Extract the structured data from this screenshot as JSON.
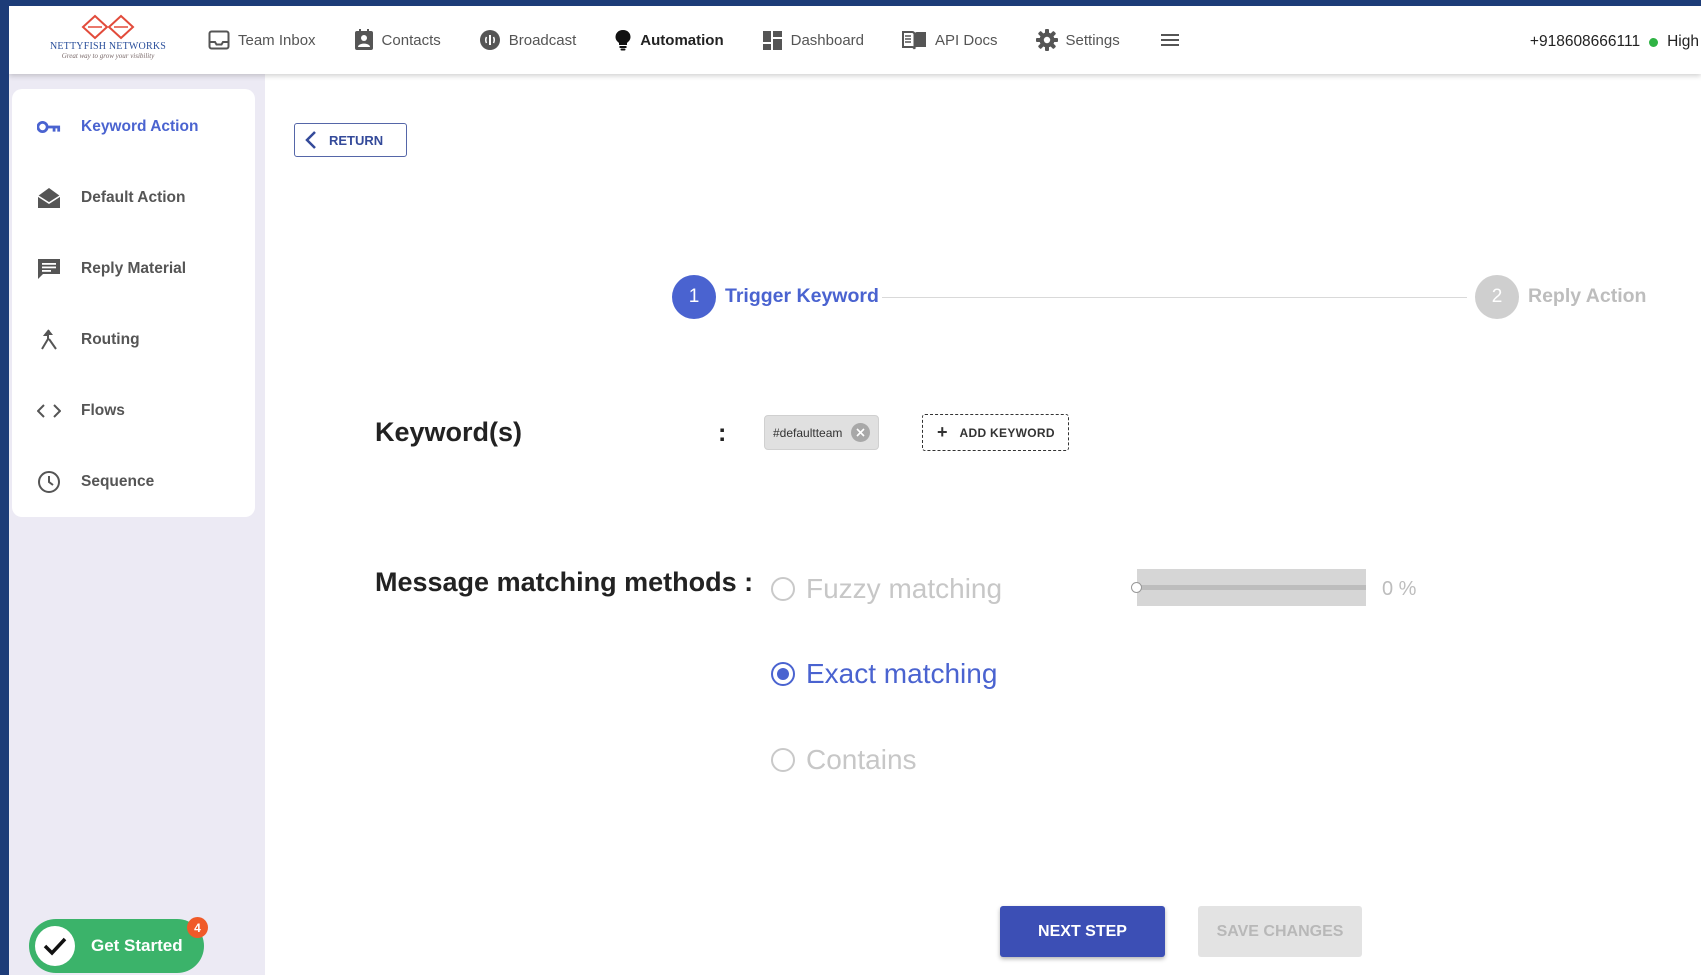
{
  "logo": {
    "brand": "NETTYFISH NETWORKS",
    "tagline": "Great way to grow your visibility"
  },
  "nav": {
    "items": [
      {
        "label": "Team Inbox",
        "icon": "inbox-icon"
      },
      {
        "label": "Contacts",
        "icon": "contacts-icon"
      },
      {
        "label": "Broadcast",
        "icon": "broadcast-icon"
      },
      {
        "label": "Automation",
        "icon": "lightbulb-icon",
        "active": true
      },
      {
        "label": "Dashboard",
        "icon": "dashboard-icon"
      },
      {
        "label": "API Docs",
        "icon": "book-icon"
      },
      {
        "label": "Settings",
        "icon": "gear-icon"
      }
    ],
    "menu_icon": "hamburger-icon"
  },
  "account": {
    "phone": "+918608666111",
    "status": "High",
    "status_color": "#2fb344"
  },
  "sidebar": {
    "items": [
      {
        "label": "Keyword Action",
        "icon": "key-icon",
        "active": true
      },
      {
        "label": "Default Action",
        "icon": "envelope-open-icon"
      },
      {
        "label": "Reply Material",
        "icon": "message-icon"
      },
      {
        "label": "Routing",
        "icon": "routing-icon"
      },
      {
        "label": "Flows",
        "icon": "code-icon"
      },
      {
        "label": "Sequence",
        "icon": "clock-icon"
      }
    ]
  },
  "main": {
    "return_label": "RETURN",
    "steps": [
      {
        "number": "1",
        "label": "Trigger Keyword",
        "active": true
      },
      {
        "number": "2",
        "label": "Reply Action",
        "active": false
      }
    ],
    "keywords": {
      "label": "Keyword(s)",
      "colon": ":",
      "chips": [
        "#defaultteam"
      ],
      "add_label": "ADD KEYWORD"
    },
    "matching": {
      "label": "Message matching methods :",
      "options": [
        {
          "label": "Fuzzy matching",
          "selected": false
        },
        {
          "label": "Exact matching",
          "selected": true
        },
        {
          "label": "Contains",
          "selected": false
        }
      ],
      "fuzzy_percent": "0 %",
      "fuzzy_value": 0
    },
    "next_label": "NEXT STEP",
    "save_label": "SAVE CHANGES"
  },
  "get_started": {
    "label": "Get Started",
    "badge": "4"
  },
  "colors": {
    "accent": "#4a63d0",
    "primary_button": "#3c4fb5",
    "get_started": "#3bb36a",
    "badge": "#f05a28"
  }
}
